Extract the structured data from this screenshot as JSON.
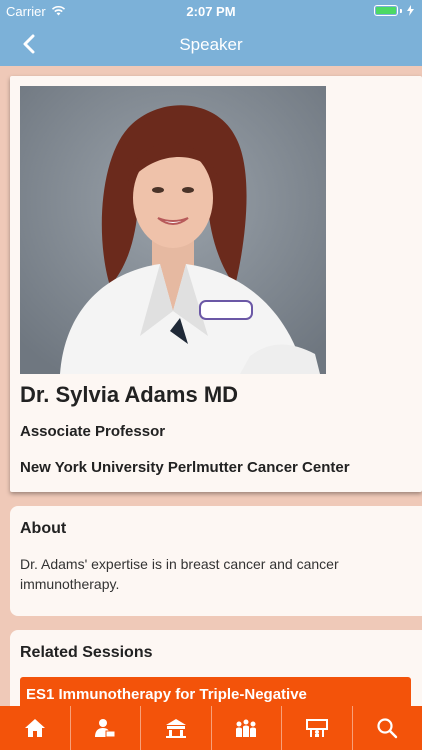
{
  "status_bar": {
    "carrier": "Carrier",
    "time": "2:07 PM"
  },
  "nav": {
    "title": "Speaker",
    "back_icon": "chevron-left-icon"
  },
  "speaker": {
    "name": "Dr. Sylvia Adams MD",
    "title": "Associate Professor",
    "organization": "New York University Perlmutter Cancer Center"
  },
  "about": {
    "heading": "About",
    "text": "Dr. Adams' expertise is in breast cancer and cancer immunotherapy."
  },
  "related_sessions": {
    "heading": "Related Sessions",
    "items": [
      {
        "title": "ES1 Immunotherapy for Triple-Negative"
      }
    ]
  },
  "tabs": [
    {
      "icon": "home-icon"
    },
    {
      "icon": "speaker-icon"
    },
    {
      "icon": "session-icon"
    },
    {
      "icon": "people-icon"
    },
    {
      "icon": "exhibitor-icon"
    },
    {
      "icon": "search-icon"
    }
  ],
  "colors": {
    "header": "#7cb1d8",
    "background": "#efc9b8",
    "card": "#fdf7f3",
    "accent": "#f3530a"
  }
}
